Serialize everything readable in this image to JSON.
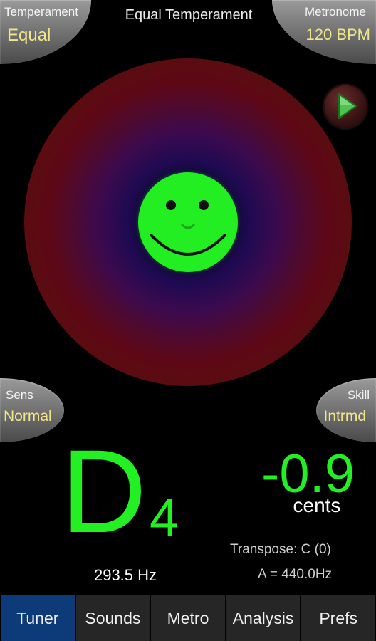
{
  "header": {
    "title": "Equal Temperament"
  },
  "temperament": {
    "label": "Temperament",
    "value": "Equal"
  },
  "metronome": {
    "label": "Metronome",
    "value": "120 BPM"
  },
  "sens": {
    "label": "Sens",
    "value": "Normal"
  },
  "skill": {
    "label": "Skill",
    "value": "Intrmd"
  },
  "play": {
    "icon": "play-icon"
  },
  "indicator": {
    "icon": "smiley-face-icon",
    "color": "#22ee22"
  },
  "reading": {
    "note": "D",
    "octave": "4",
    "cents": "-0.9",
    "cents_unit": "cents",
    "frequency": "293.5 Hz",
    "transpose": "Transpose: C (0)",
    "reference": "A = 440.0Hz",
    "color": "#22f022"
  },
  "tabs": [
    {
      "label": "Tuner",
      "active": true
    },
    {
      "label": "Sounds",
      "active": false
    },
    {
      "label": "Metro",
      "active": false
    },
    {
      "label": "Analysis",
      "active": false
    },
    {
      "label": "Prefs",
      "active": false
    }
  ],
  "colors": {
    "active_tab": "#0d3b7a",
    "corner_value": "#f2e68a"
  }
}
